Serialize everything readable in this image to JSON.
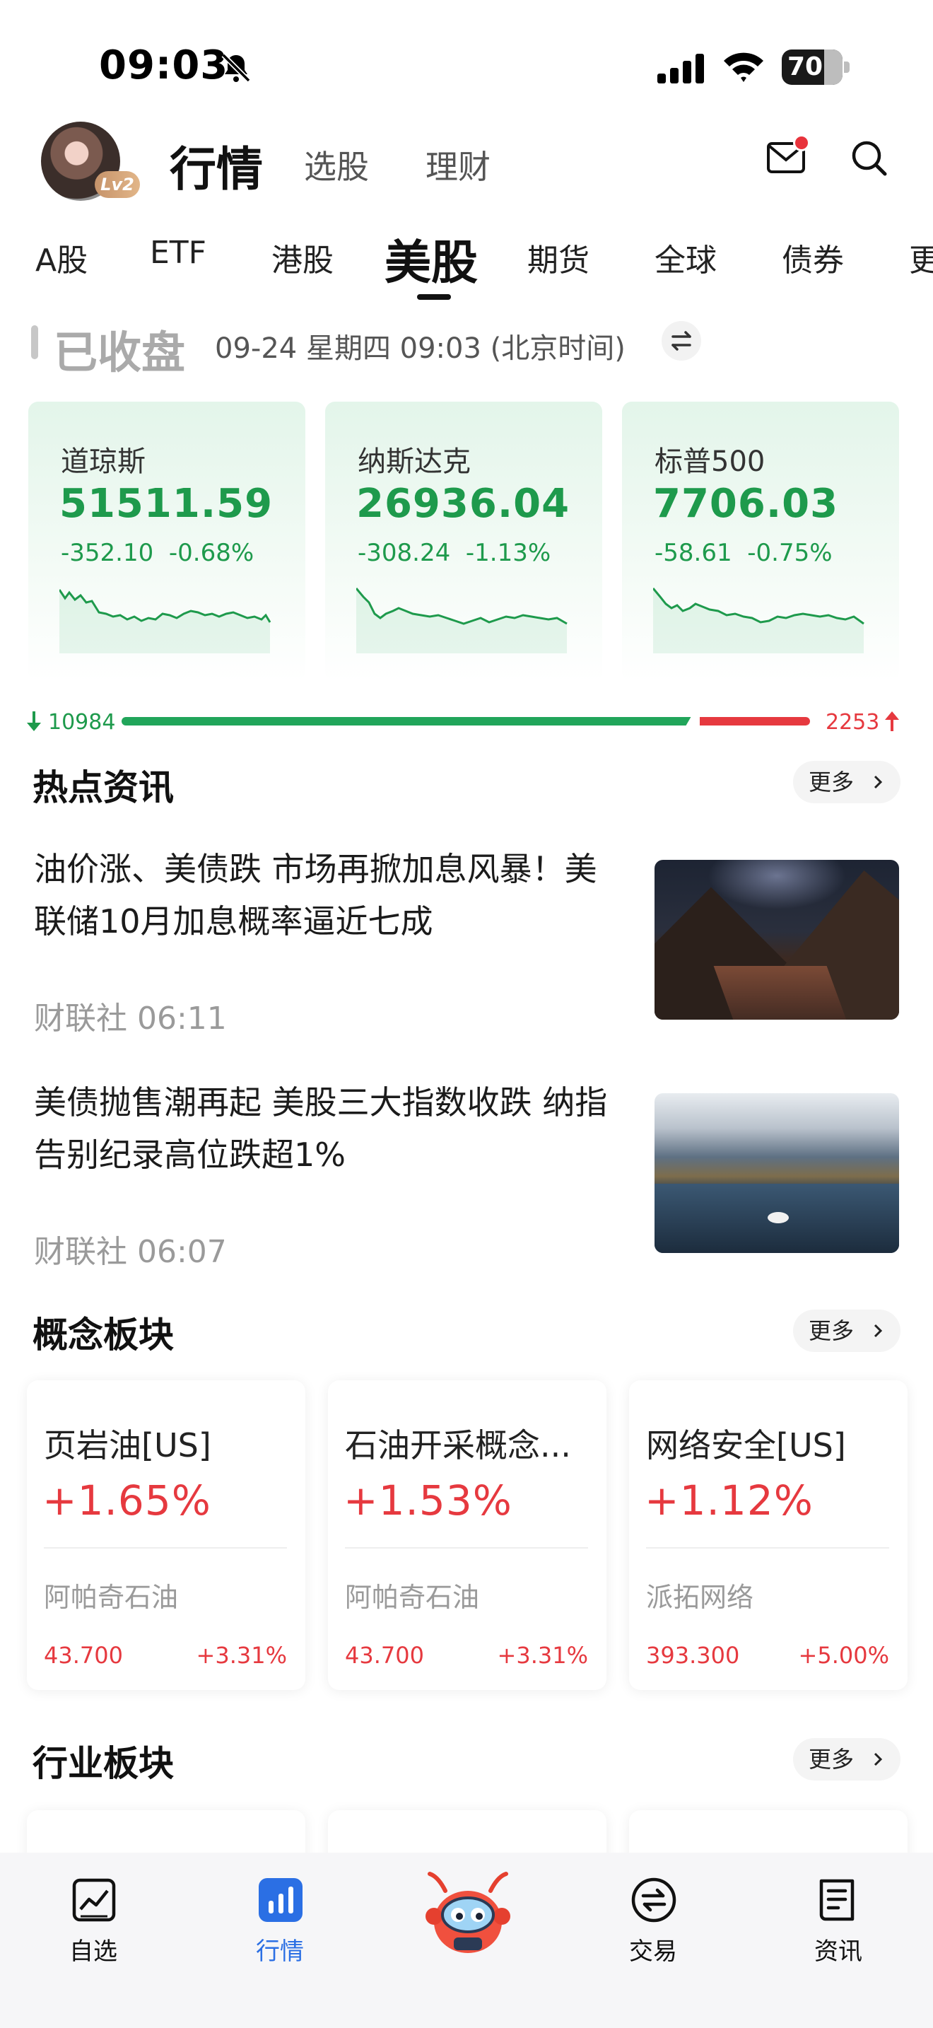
{
  "status_bar": {
    "time": "09:03",
    "battery": "70"
  },
  "header": {
    "avatar_level": "Lv2",
    "tabs": [
      {
        "label": "行情",
        "active": true
      },
      {
        "label": "选股",
        "active": false
      },
      {
        "label": "理财",
        "active": false
      }
    ],
    "mail_has_unread": true
  },
  "market_tabs": [
    {
      "label": "A股"
    },
    {
      "label": "ETF"
    },
    {
      "label": "港股"
    },
    {
      "label": "美股",
      "active": true
    },
    {
      "label": "期货"
    },
    {
      "label": "全球"
    },
    {
      "label": "债券"
    },
    {
      "label": "更"
    }
  ],
  "market_status": {
    "label": "已收盘",
    "timestamp": "09-24 星期四 09:03 (北京时间)"
  },
  "indices": [
    {
      "name": "道琼斯",
      "value": "51511.59",
      "change": "-352.10",
      "change_pct": "-0.68%"
    },
    {
      "name": "纳斯达克",
      "value": "26936.04",
      "change": "-308.24",
      "change_pct": "-1.13%"
    },
    {
      "name": "标普500",
      "value": "7706.03",
      "change": "-58.61",
      "change_pct": "-0.75%"
    }
  ],
  "breadth": {
    "down": "10984",
    "up": "2253",
    "down_fraction": 0.83
  },
  "hot_news": {
    "title": "热点资讯",
    "more": "更多",
    "items": [
      {
        "title": " 油价涨、美债跌 市场再掀加息风暴！美联储10月加息概率逼近七成",
        "source_time": "财联社 06:11"
      },
      {
        "title": " 美债抛售潮再起 美股三大指数收跌 纳指告别纪录高位跌超1%",
        "source_time": "财联社 06:07"
      }
    ]
  },
  "concept_blocks": {
    "title": "概念板块",
    "more": "更多",
    "items": [
      {
        "name": "页岩油[US]",
        "change_pct": "+1.65%",
        "lead_stock": "阿帕奇石油",
        "price": "43.700",
        "stock_change": "+3.31%"
      },
      {
        "name": "石油开采概念...",
        "change_pct": "+1.53%",
        "lead_stock": "阿帕奇石油",
        "price": "43.700",
        "stock_change": "+3.31%"
      },
      {
        "name": "网络安全[US]",
        "change_pct": "+1.12%",
        "lead_stock": "派拓网络",
        "price": "393.300",
        "stock_change": "+5.00%"
      }
    ]
  },
  "industry_blocks": {
    "title": "行业板块",
    "more": "更多"
  },
  "bottom_nav": [
    {
      "label": "自选",
      "icon": "chart-line-icon"
    },
    {
      "label": "行情",
      "icon": "bar-chart-icon",
      "active": true
    },
    {
      "label": "",
      "icon": "mascot-icon"
    },
    {
      "label": "交易",
      "icon": "exchange-icon"
    },
    {
      "label": "资讯",
      "icon": "news-icon"
    }
  ],
  "colors": {
    "down": "#1e9a4c",
    "up": "#e6393f",
    "active_nav": "#2b6fe4"
  }
}
